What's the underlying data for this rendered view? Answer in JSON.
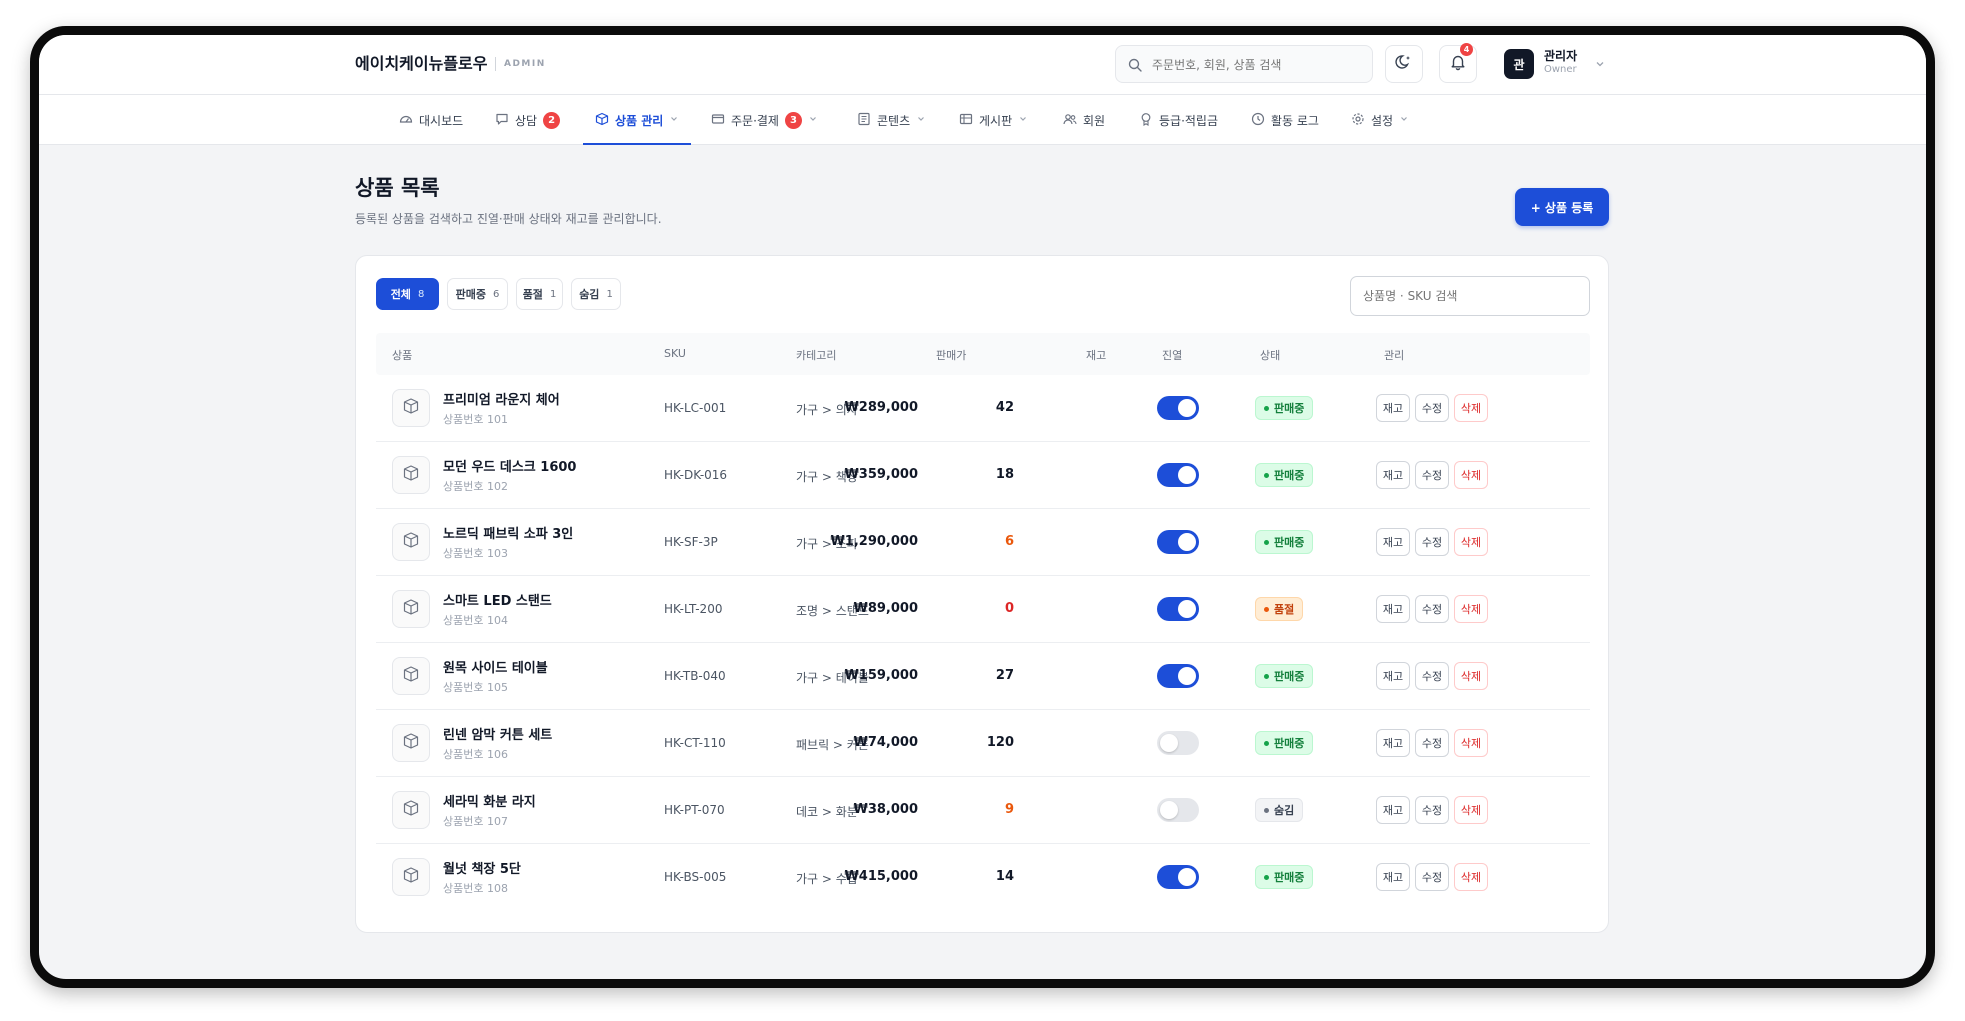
{
  "brand": {
    "name": "에이치케이뉴플로우",
    "tag": "ADMIN"
  },
  "search": {
    "placeholder": "주문번호, 회원, 상품 검색"
  },
  "notifications": {
    "count": "4"
  },
  "user": {
    "avatar": "관",
    "name": "관리자",
    "role": "Owner"
  },
  "nav": [
    {
      "label": "대시보드",
      "icon": "dashboard-icon"
    },
    {
      "label": "상담",
      "icon": "chat-icon",
      "badge": "2"
    },
    {
      "label": "상품 관리",
      "icon": "box-icon",
      "active": true,
      "dropdown": true
    },
    {
      "label": "주문·결제",
      "icon": "card-icon",
      "badge": "3",
      "dropdown": true
    },
    {
      "label": "콘텐츠",
      "icon": "content-icon",
      "dropdown": true
    },
    {
      "label": "게시판",
      "icon": "board-icon",
      "dropdown": true
    },
    {
      "label": "회원",
      "icon": "users-icon"
    },
    {
      "label": "등급·적립금",
      "icon": "medal-icon"
    },
    {
      "label": "활동 로그",
      "icon": "clock-icon"
    },
    {
      "label": "설정",
      "icon": "gear-icon",
      "dropdown": true
    }
  ],
  "page": {
    "title": "상품 목록",
    "subtitle": "등록된 상품을 검색하고 진열·판매 상태와 재고를 관리합니다.",
    "add_button": "+ 상품 등록"
  },
  "filters": [
    {
      "label": "전체",
      "count": "8",
      "active": true
    },
    {
      "label": "판매중",
      "count": "6"
    },
    {
      "label": "품절",
      "count": "1"
    },
    {
      "label": "숨김",
      "count": "1"
    }
  ],
  "table_search": {
    "placeholder": "상품명 · SKU 검색"
  },
  "columns": [
    "상품",
    "SKU",
    "카테고리",
    "판매가",
    "재고",
    "진열",
    "상태",
    "관리"
  ],
  "actions": {
    "stock": "재고",
    "edit": "수정",
    "delete": "삭제"
  },
  "rows": [
    {
      "name": "프리미엄 라운지 체어",
      "no": "상품번호 101",
      "sku": "HK-LC-001",
      "category": "가구 > 의자",
      "price": "₩289,000",
      "stock": "42",
      "stock_level": "normal",
      "display": true,
      "status": "판매중",
      "status_type": "sale"
    },
    {
      "name": "모던 우드 데스크 1600",
      "no": "상품번호 102",
      "sku": "HK-DK-016",
      "category": "가구 > 책상",
      "price": "₩359,000",
      "stock": "18",
      "stock_level": "normal",
      "display": true,
      "status": "판매중",
      "status_type": "sale"
    },
    {
      "name": "노르딕 패브릭 소파 3인",
      "no": "상품번호 103",
      "sku": "HK-SF-3P",
      "category": "가구 > 소파",
      "price": "₩1,290,000",
      "stock": "6",
      "stock_level": "warn",
      "display": true,
      "status": "판매중",
      "status_type": "sale"
    },
    {
      "name": "스마트 LED 스탠드",
      "no": "상품번호 104",
      "sku": "HK-LT-200",
      "category": "조명 > 스탠드",
      "price": "₩89,000",
      "stock": "0",
      "stock_level": "zero",
      "display": true,
      "status": "품절",
      "status_type": "sold"
    },
    {
      "name": "원목 사이드 테이블",
      "no": "상품번호 105",
      "sku": "HK-TB-040",
      "category": "가구 > 테이블",
      "price": "₩159,000",
      "stock": "27",
      "stock_level": "normal",
      "display": true,
      "status": "판매중",
      "status_type": "sale"
    },
    {
      "name": "린넨 암막 커튼 세트",
      "no": "상품번호 106",
      "sku": "HK-CT-110",
      "category": "패브릭 > 커튼",
      "price": "₩74,000",
      "stock": "120",
      "stock_level": "normal",
      "display": false,
      "status": "판매중",
      "status_type": "sale"
    },
    {
      "name": "세라믹 화분 라지",
      "no": "상품번호 107",
      "sku": "HK-PT-070",
      "category": "데코 > 화분",
      "price": "₩38,000",
      "stock": "9",
      "stock_level": "warn",
      "display": false,
      "status": "숨김",
      "status_type": "hidden"
    },
    {
      "name": "월넛 책장 5단",
      "no": "상품번호 108",
      "sku": "HK-BS-005",
      "category": "가구 > 수납",
      "price": "₩415,000",
      "stock": "14",
      "stock_level": "normal",
      "display": true,
      "status": "판매중",
      "status_type": "sale"
    }
  ]
}
